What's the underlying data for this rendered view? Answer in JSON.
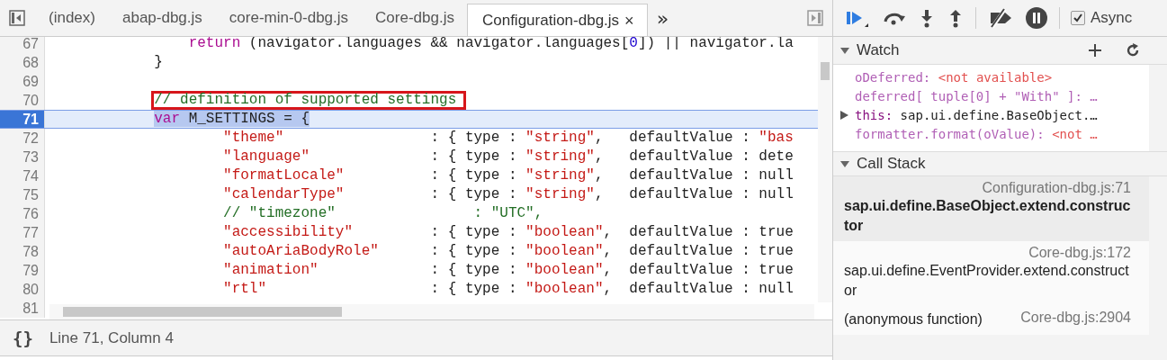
{
  "tabs": [
    {
      "label": "(index)",
      "selected": false
    },
    {
      "label": "abap-dbg.js",
      "selected": false
    },
    {
      "label": "core-min-0-dbg.js",
      "selected": false
    },
    {
      "label": "Core-dbg.js",
      "selected": false
    },
    {
      "label": "Configuration-dbg.js",
      "selected": true,
      "close": "×"
    }
  ],
  "more_tabs": "»",
  "code_lines": [
    {
      "number": "67",
      "selected": false,
      "tokens": [
        {
          "kind": "keyword",
          "text": "                return"
        },
        {
          "kind": "plain",
          "text": " (navigator.languages && navigator.languages["
        },
        {
          "kind": "number",
          "text": "0"
        },
        {
          "kind": "plain",
          "text": "]) || navigator.la"
        }
      ]
    },
    {
      "number": "68",
      "selected": false,
      "tokens": [
        {
          "kind": "plain",
          "text": "            }"
        }
      ]
    },
    {
      "number": "69",
      "selected": false
    },
    {
      "number": "70",
      "selected": false,
      "boxed": true,
      "tokens": [
        {
          "kind": "comment",
          "text": "            // definition of supported settings"
        }
      ]
    },
    {
      "number": "71",
      "selected": true,
      "tokens": [
        {
          "kind": "keyword",
          "text": "            var"
        },
        {
          "kind": "plain",
          "text": " M_SETTINGS = {"
        }
      ]
    },
    {
      "number": "72",
      "selected": false,
      "tokens": [
        {
          "kind": "string",
          "text": "                    \"theme\""
        },
        {
          "kind": "plain",
          "text": "                 : { type : "
        },
        {
          "kind": "string",
          "text": "\"string\""
        },
        {
          "kind": "plain",
          "text": ",   defaultValue : "
        },
        {
          "kind": "string",
          "text": "\"bas"
        }
      ]
    },
    {
      "number": "73",
      "selected": false,
      "tokens": [
        {
          "kind": "string",
          "text": "                    \"language\""
        },
        {
          "kind": "plain",
          "text": "              : { type : "
        },
        {
          "kind": "string",
          "text": "\"string\""
        },
        {
          "kind": "plain",
          "text": ",   defaultValue : dete"
        }
      ]
    },
    {
      "number": "74",
      "selected": false,
      "tokens": [
        {
          "kind": "string",
          "text": "                    \"formatLocale\""
        },
        {
          "kind": "plain",
          "text": "          : { type : "
        },
        {
          "kind": "string",
          "text": "\"string\""
        },
        {
          "kind": "plain",
          "text": ",   defaultValue : null"
        }
      ]
    },
    {
      "number": "75",
      "selected": false,
      "tokens": [
        {
          "kind": "string",
          "text": "                    \"calendarType\""
        },
        {
          "kind": "plain",
          "text": "          : { type : "
        },
        {
          "kind": "string",
          "text": "\"string\""
        },
        {
          "kind": "plain",
          "text": ",   defaultValue : null"
        }
      ]
    },
    {
      "number": "76",
      "selected": false,
      "tokens": [
        {
          "kind": "comment",
          "text": "                    // \"timezone\"                : \"UTC\","
        }
      ]
    },
    {
      "number": "77",
      "selected": false,
      "tokens": [
        {
          "kind": "string",
          "text": "                    \"accessibility\""
        },
        {
          "kind": "plain",
          "text": "         : { type : "
        },
        {
          "kind": "string",
          "text": "\"boolean\""
        },
        {
          "kind": "plain",
          "text": ",  defaultValue : true"
        }
      ]
    },
    {
      "number": "78",
      "selected": false,
      "tokens": [
        {
          "kind": "string",
          "text": "                    \"autoAriaBodyRole\""
        },
        {
          "kind": "plain",
          "text": "      : { type : "
        },
        {
          "kind": "string",
          "text": "\"boolean\""
        },
        {
          "kind": "plain",
          "text": ",  defaultValue : true"
        }
      ]
    },
    {
      "number": "79",
      "selected": false,
      "tokens": [
        {
          "kind": "string",
          "text": "                    \"animation\""
        },
        {
          "kind": "plain",
          "text": "             : { type : "
        },
        {
          "kind": "string",
          "text": "\"boolean\""
        },
        {
          "kind": "plain",
          "text": ",  defaultValue : true"
        }
      ]
    },
    {
      "number": "80",
      "selected": false,
      "tokens": [
        {
          "kind": "string",
          "text": "                    \"rtl\""
        },
        {
          "kind": "plain",
          "text": "                   : { type : "
        },
        {
          "kind": "string",
          "text": "\"boolean\""
        },
        {
          "kind": "plain",
          "text": ",  defaultValue : null"
        }
      ]
    },
    {
      "number": "81",
      "selected": false
    }
  ],
  "status_bar": {
    "format_icon": "{}",
    "position": "Line 71, Column 4"
  },
  "debugger": {
    "async": {
      "label": "Async",
      "checked": true
    }
  },
  "watch": {
    "title": "Watch",
    "expanded": true,
    "items": [
      {
        "name": "oDeferred:",
        "value": "<not available>",
        "kind": "error",
        "expandable": false
      },
      {
        "name": "deferred[ tuple[0] + \"With\" ]:",
        "value": "…",
        "kind": "plain",
        "expandable": false
      },
      {
        "name": "this:",
        "value": "sap.ui.define.BaseObject.…",
        "kind": "object",
        "expandable": true
      },
      {
        "name": "formatter.format(oValue):",
        "value": "<not …",
        "kind": "error",
        "expandable": false
      }
    ]
  },
  "call_stack": {
    "title": "Call Stack",
    "expanded": true,
    "frames": [
      {
        "function": "sap.ui.define.BaseObject.extend.constructor",
        "location": "Configuration-dbg.js:71",
        "selected": true,
        "inline": false
      },
      {
        "function": "sap.ui.define.EventProvider.extend.constructor",
        "location": "Core-dbg.js:172",
        "selected": false,
        "inline": false
      },
      {
        "function": "(anonymous function)",
        "location": "Core-dbg.js:2904",
        "selected": false,
        "inline": true
      }
    ]
  }
}
